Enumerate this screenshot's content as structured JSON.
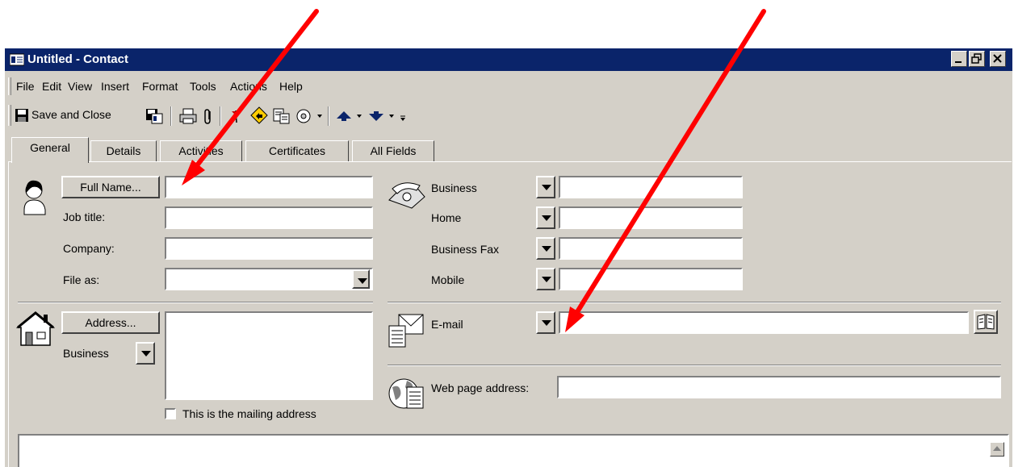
{
  "window": {
    "title": "Untitled - Contact",
    "controls": [
      "minimize",
      "restore",
      "close"
    ]
  },
  "menu": [
    "File",
    "Edit",
    "View",
    "Insert",
    "Format",
    "Tools",
    "Actions",
    "Help"
  ],
  "toolbar": {
    "save_close_label": "Save and Close",
    "icons": [
      "save-icon",
      "save-as-vcard-icon",
      "print-icon",
      "attach-icon",
      "flag-icon",
      "categories-icon",
      "call-icon",
      "dial-icon",
      "previous-item-icon",
      "next-item-icon"
    ]
  },
  "tabs": [
    "General",
    "Details",
    "Activities",
    "Certificates",
    "All Fields"
  ],
  "name_section": {
    "full_name_button": "Full Name...",
    "full_name_value": "",
    "job_title_label": "Job title:",
    "job_title_value": "",
    "company_label": "Company:",
    "company_value": "",
    "file_as_label": "File as:",
    "file_as_value": ""
  },
  "phone_section": {
    "phones": [
      {
        "label": "Business",
        "value": ""
      },
      {
        "label": "Home",
        "value": ""
      },
      {
        "label": "Business Fax",
        "value": ""
      },
      {
        "label": "Mobile",
        "value": ""
      }
    ]
  },
  "address_section": {
    "address_button": "Address...",
    "address_type": "Business",
    "address_value": "",
    "mailing_checkbox_label": "This is the mailing address",
    "mailing_checked": false
  },
  "email_section": {
    "email_label": "E-mail",
    "email_value": "",
    "web_label": "Web page address:",
    "web_value": ""
  },
  "colors": {
    "titlebar": "#0a246a",
    "face": "#d4d0c8",
    "annotation_arrow": "#ff0000"
  }
}
